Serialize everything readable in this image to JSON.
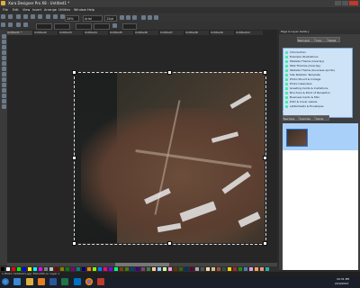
{
  "app": {
    "title": "Xara Designer Pro X8 - Untitled1 *"
  },
  "menu": {
    "items": [
      "File",
      "Edit",
      "View",
      "Insert",
      "Arrange",
      "Utilities",
      "Window",
      "Help"
    ]
  },
  "toolbar": {
    "zoom_value": "26%",
    "font_name": "Arial",
    "font_size": "12pt"
  },
  "tabs": {
    "items": [
      "Untitled1 *",
      "Untitled2",
      "Untitled3",
      "Untitled4",
      "Untitled5",
      "Untitled6",
      "Untitled7",
      "Untitled8",
      "Untitled9",
      "Untitled10"
    ]
  },
  "right_panel": {
    "header": "Page & Layer Gallery",
    "top_buttons": [
      "New Layer",
      "Copy",
      "Delete"
    ],
    "list_items": [
      "Introduction",
      "Example Illustrations",
      "Website Theme (Overlay)",
      "Web Themes (Overlay)",
      "Website Theme (business sports)",
      "Site Rotation Template",
      "Photo Mount & Collage",
      "Photo Calendars",
      "Greeting Cards & Invitations",
      "Brochure & Point of Reception",
      "Business Cards & Mini",
      "DVD & Cover Labels",
      "Letterheads & Envelopes"
    ],
    "pages_header": "Page Gallery",
    "pages_buttons": [
      "New Page",
      "Duplicate",
      "Delete"
    ]
  },
  "status": {
    "text": "1 Photo 'Untitled1.jpg' 300x200 on Layer 1"
  },
  "taskbar": {
    "clock_time": "10:31 PM",
    "clock_date": "2/16/2013"
  },
  "colors": {
    "accent": "#4a90e2",
    "canvas_bg": "#262626",
    "panel_bg": "#3d3d3d",
    "list_bg": "#cfe3f7",
    "selection_highlight": "#2a6fd1",
    "palette": [
      "#000000",
      "#ffffff",
      "#ff0000",
      "#00ff00",
      "#0000ff",
      "#ffff00",
      "#00ffff",
      "#ff00ff",
      "#808080",
      "#c0c0c0",
      "#800000",
      "#808000",
      "#008000",
      "#800080",
      "#008080",
      "#000080",
      "#ff8000",
      "#80ff00",
      "#0080ff",
      "#ff0080",
      "#8000ff",
      "#00ff80",
      "#804000",
      "#408000",
      "#004080",
      "#400080",
      "#804080",
      "#408040",
      "#ffcc99",
      "#99ccff",
      "#ccff99",
      "#ff99cc",
      "#663300",
      "#336600",
      "#003366",
      "#660033",
      "#aaaaaa",
      "#555555",
      "#f5deb3",
      "#deb887",
      "#a0522d",
      "#2f4f4f",
      "#ffd700",
      "#b22222",
      "#228b22",
      "#4682b4",
      "#dda0dd",
      "#f4a460",
      "#e9967a",
      "#20b2aa"
    ]
  },
  "icons": {
    "taskbar": [
      "start-icon",
      "ie-icon",
      "folder-icon",
      "media-icon",
      "word-icon",
      "excel-icon",
      "outlook-icon",
      "chrome-icon",
      "xara-icon"
    ]
  }
}
